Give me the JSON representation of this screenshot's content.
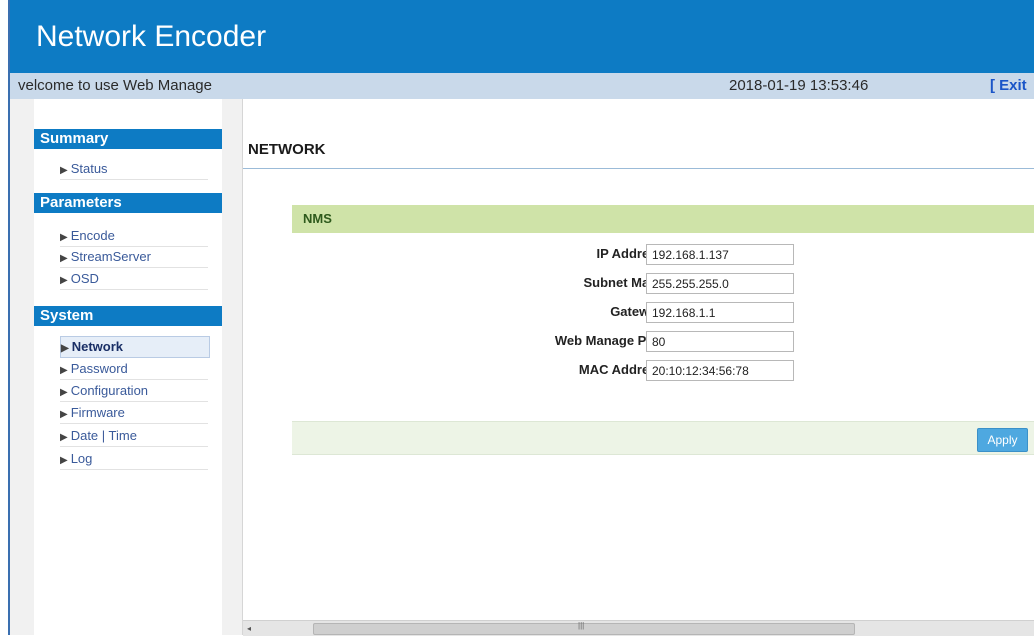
{
  "header": {
    "title": "Network Encoder"
  },
  "subbar": {
    "welcome": "velcome to use Web Managе",
    "datetime": "2018-01-19 13:53:46",
    "exit_label": "[ Exit ]"
  },
  "sidebar": {
    "sections": [
      {
        "title": "Summary",
        "items": [
          {
            "label": "Status"
          }
        ]
      },
      {
        "title": "Parameters",
        "items": [
          {
            "label": "Encode"
          },
          {
            "label": "StreamServer"
          },
          {
            "label": "OSD"
          }
        ]
      },
      {
        "title": "System",
        "items": [
          {
            "label": "Network",
            "active": true
          },
          {
            "label": "Password"
          },
          {
            "label": "Configuration"
          },
          {
            "label": "Firmware"
          },
          {
            "label": "Date | Time"
          },
          {
            "label": "Log"
          }
        ]
      }
    ]
  },
  "main": {
    "page_title": "NETWORK",
    "section_label": "NMS",
    "fields": [
      {
        "label": "IP Address:",
        "value": "192.168.1.137"
      },
      {
        "label": "Subnet Mask:",
        "value": "255.255.255.0"
      },
      {
        "label": "Gateway:",
        "value": "192.168.1.1"
      },
      {
        "label": "Web Manage Port:",
        "value": "80"
      },
      {
        "label": "MAC Address:",
        "value": "20:10:12:34:56:78"
      }
    ],
    "apply_label": "Apply"
  },
  "scrollbar": {
    "left_arrow": "◂",
    "grip": "|||"
  },
  "icons": {
    "nav_arrow": "triangle-right-icon"
  },
  "colors": {
    "header": "#0d7bc4",
    "nms_bar": "#cfe3a8",
    "apply_button": "#4ea8e0"
  }
}
